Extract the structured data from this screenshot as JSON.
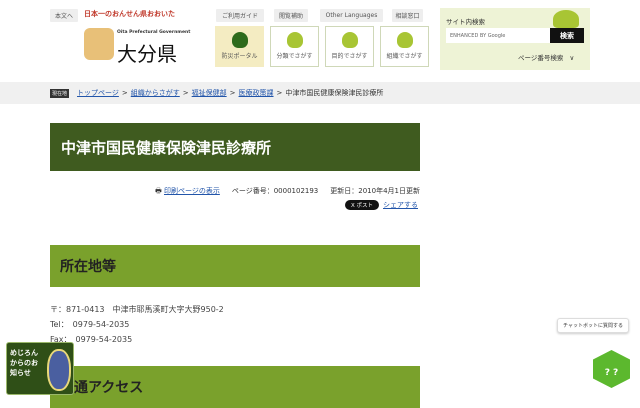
{
  "header": {
    "skip_link": "本文へ",
    "slogan": "日本一のおんせん県おおいた",
    "logo_en": "Oita Prefectural Government",
    "logo_ja": "大分県",
    "top_links": [
      "ご利用ガイド",
      "閲覧補助",
      "Other Languages",
      "相談窓口"
    ],
    "tiles": [
      "防災ポータル",
      "分類でさがす",
      "目的でさがす",
      "組織でさがす"
    ],
    "search": {
      "title": "サイト内検索",
      "placeholder": "ENHANCED BY Google",
      "button": "検索",
      "page_number_search": "ページ番号検索"
    }
  },
  "breadcrumb": {
    "badge": "現在地",
    "links": [
      "トップページ",
      "組織からさがす",
      "福祉保健部",
      "医療政策課"
    ],
    "current": "中津市国民健康保険津民診療所",
    "sep": ">"
  },
  "page": {
    "title": "中津市国民健康保険津民診療所",
    "print_link": "印刷ページの表示",
    "page_number": "ページ番号：0000102193",
    "updated": "更新日：2010年4月1日更新",
    "x_post": "X ポスト",
    "share": "シェアする"
  },
  "sections": [
    {
      "heading": "所在地等",
      "lines": [
        "〒：871-0413　中津市耶馬溪町大字大野950-2",
        "Tel：　0979-54-2035",
        "Fax：　0979-54-2035"
      ]
    },
    {
      "heading": "交通アクセス"
    }
  ],
  "widgets": {
    "mejiron": "めじろんからのお知らせ",
    "chatbot_tooltip": "チャットボットに質問する",
    "chatbot_icon": "? ?"
  }
}
